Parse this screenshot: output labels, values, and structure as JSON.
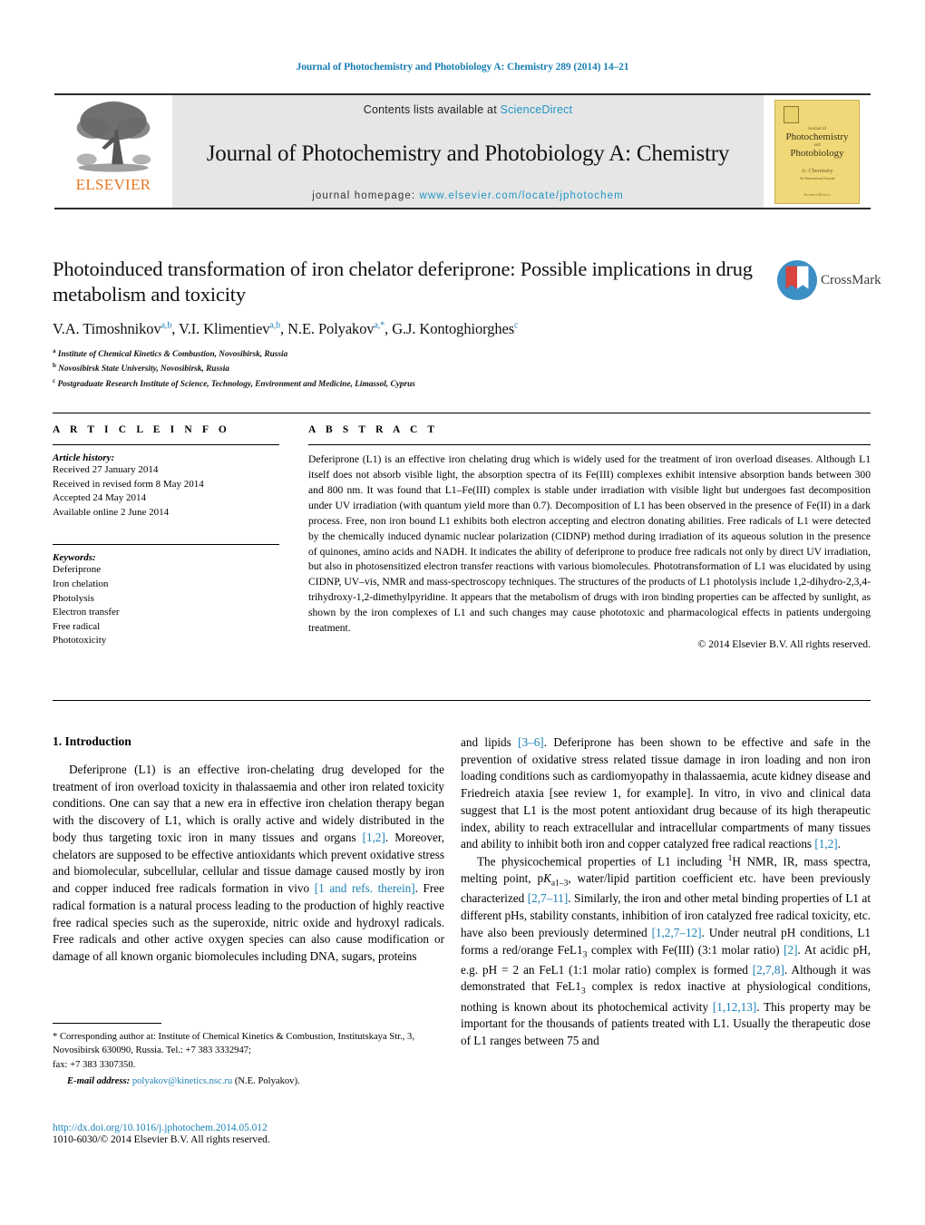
{
  "running_head": "Journal of Photochemistry and Photobiology A: Chemistry 289 (2014) 14–21",
  "masthead": {
    "publisher": "ELSEVIER",
    "contents_prefix": "Contents lists available at ",
    "sciencedirect": "ScienceDirect",
    "journal_title": "Journal of Photochemistry and Photobiology A: Chemistry",
    "homepage_label": "journal homepage:",
    "homepage_url": "www.elsevier.com/locate/jphotochem",
    "cover": {
      "line_small": "Journal of",
      "line1": "Photochemistry",
      "and": "and",
      "line2": "Photobiology",
      "subtitle": "A: Chemistry",
      "tiny": "An International Journal",
      "bottom": "ScienceDirect"
    },
    "accent_link_color": "#2196c4",
    "elsevier_orange": "#e87722"
  },
  "article": {
    "title": "Photoinduced transformation of iron chelator deferiprone: Possible implications in drug metabolism and toxicity",
    "authors_html": "V.A. Timoshnikov<sup>a,b</sup>, V.I. Klimentiev<sup>a,b</sup>, N.E. Polyakov<sup>a,*</sup>, G.J. Kontoghiorghes<sup>c</sup>",
    "affiliations": [
      {
        "marker": "a",
        "text": "Institute of Chemical Kinetics & Combustion, Novosibirsk, Russia"
      },
      {
        "marker": "b",
        "text": "Novosibirsk State University, Novosibirsk, Russia"
      },
      {
        "marker": "c",
        "text": "Postgraduate Research Institute of Science, Technology, Environment and Medicine, Limassol, Cyprus"
      }
    ],
    "crossmark_label": "CrossMark"
  },
  "article_info": {
    "heading": "A R T I C L E    I N F O",
    "history_label": "Article history:",
    "history": [
      "Received 27 January 2014",
      "Received in revised form 8 May 2014",
      "Accepted 24 May 2014",
      "Available online 2 June 2014"
    ],
    "keywords_label": "Keywords:",
    "keywords": [
      "Deferiprone",
      "Iron chelation",
      "Photolysis",
      "Electron transfer",
      "Free radical",
      "Phototoxicity"
    ]
  },
  "abstract": {
    "heading": "A B S T R A C T",
    "text": "Deferiprone (L1) is an effective iron chelating drug which is widely used for the treatment of iron overload diseases. Although L1 itself does not absorb visible light, the absorption spectra of its Fe(III) complexes exhibit intensive absorption bands between 300 and 800 nm. It was found that L1–Fe(III) complex is stable under irradiation with visible light but undergoes fast decomposition under UV irradiation (with quantum yield more than 0.7). Decomposition of L1 has been observed in the presence of Fe(II) in a dark process. Free, non iron bound L1 exhibits both electron accepting and electron donating abilities. Free radicals of L1 were detected by the chemically induced dynamic nuclear polarization (CIDNP) method during irradiation of its aqueous solution in the presence of quinones, amino acids and NADH. It indicates the ability of deferiprone to produce free radicals not only by direct UV irradiation, but also in photosensitized electron transfer reactions with various biomolecules. Phototransformation of L1 was elucidated by using CIDNP, UV–vis, NMR and mass-spectroscopy techniques. The structures of the products of L1 photolysis include 1,2-dihydro-2,3,4-trihydroxy-1,2-dimethylpyridine. It appears that the metabolism of drugs with iron binding properties can be affected by sunlight, as shown by the iron complexes of L1 and such changes may cause phototoxic and pharmacological effects in patients undergoing treatment.",
    "copyright": "© 2014 Elsevier B.V. All rights reserved."
  },
  "body": {
    "section_number_title": "1.  Introduction",
    "left_paragraphs": [
      "Deferiprone (L1) is an effective iron-chelating drug developed for the treatment of iron overload toxicity in thalassaemia and other iron related toxicity conditions. One can say that a new era in effective iron chelation therapy began with the discovery of L1, which is orally active and widely distributed in the body thus targeting toxic iron in many tissues and organs [1,2]. Moreover, chelators are supposed to be effective antioxidants which prevent oxidative stress and biomolecular, subcellular, cellular and tissue damage caused mostly by iron and copper induced free radicals formation in vivo [1 and refs. therein]. Free radical formation is a natural process leading to the production of highly reactive free radical species such as the superoxide, nitric oxide and hydroxyl radicals. Free radicals and other active oxygen species can also cause modification or damage of all known organic biomolecules including DNA, sugars, proteins"
    ],
    "right_paragraphs": [
      "and lipids [3–6]. Deferiprone has been shown to be effective and safe in the prevention of oxidative stress related tissue damage in iron loading and non iron loading conditions such as cardiomyopathy in thalassaemia, acute kidney disease and Friedreich ataxia [see review 1, for example]. In vitro, in vivo and clinical data suggest that L1 is the most potent antioxidant drug because of its high therapeutic index, ability to reach extracellular and intracellular compartments of many tissues and ability to inhibit both iron and copper catalyzed free radical reactions [1,2].",
      "The physicochemical properties of L1 including 1H NMR, IR, mass spectra, melting point, pKa1–3, water/lipid partition coefficient etc. have been previously characterized [2,7–11]. Similarly, the iron and other metal binding properties of L1 at different pHs, stability constants, inhibition of iron catalyzed free radical toxicity, etc. have also been previously determined [1,2,7–12]. Under neutral pH conditions, L1 forms a red/orange FeL13 complex with Fe(III) (3:1 molar ratio) [2]. At acidic pH, e.g. pH = 2 an FeL1 (1:1 molar ratio) complex is formed [2,7,8]. Although it was demonstrated that FeL13 complex is redox inactive at physiological conditions, nothing is known about its photochemical activity [1,12,13]. This property may be important for the thousands of patients treated with L1. Usually the therapeutic dose of L1 ranges between 75 and"
    ]
  },
  "footnote": {
    "corresponding": "* Corresponding author at: Institute of Chemical Kinetics & Combustion, Institutskaya Str., 3, Novosibirsk 630090, Russia. Tel.: +7 383 3332947;",
    "fax": "fax: +7 383 3307350.",
    "email_label": "E-mail address:",
    "email": "polyakov@kinetics.nsc.ru",
    "email_owner": "(N.E. Polyakov).",
    "doi": "http://dx.doi.org/10.1016/j.jphotochem.2014.05.012",
    "issn": "1010-6030/© 2014 Elsevier B.V. All rights reserved."
  }
}
